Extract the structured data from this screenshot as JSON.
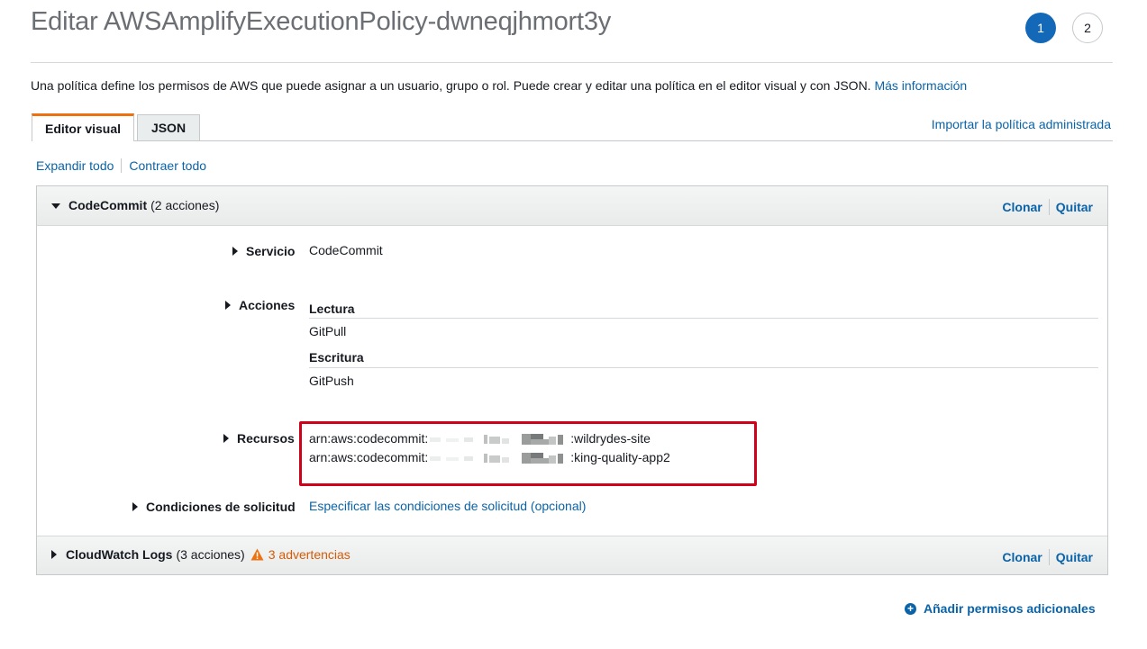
{
  "page": {
    "title": "Editar AWSAmplifyExecutionPolicy-dwneqjhmort3y",
    "steps": [
      "1",
      "2"
    ],
    "intro": "Una política define los permisos de AWS que puede asignar a un usuario, grupo o rol. Puede crear y editar una política en el editor visual y con JSON.",
    "more_info": "Más información"
  },
  "tabs": [
    {
      "label": "Editor visual",
      "active": true
    },
    {
      "label": "JSON",
      "active": false
    }
  ],
  "import_link": "Importar la política administrada",
  "expand_all": "Expandir todo",
  "collapse_all": "Contraer todo",
  "sections": [
    {
      "service": "CodeCommit",
      "count": "(2 acciones)",
      "expanded": true,
      "clone": "Clonar",
      "remove": "Quitar",
      "details": {
        "service_label": "Servicio",
        "service_value": "CodeCommit",
        "actions_label": "Acciones",
        "read_heading": "Lectura",
        "read_action": "GitPull",
        "write_heading": "Escritura",
        "write_action": "GitPush",
        "resources_label": "Recursos",
        "resource_prefix": "arn:aws:codecommit:",
        "resources": [
          ":wildrydes-site",
          ":king-quality-app2"
        ],
        "conditions_label": "Condiciones de solicitud",
        "conditions_link": "Especificar las condiciones de solicitud (opcional)"
      }
    },
    {
      "service": "CloudWatch Logs",
      "count": "(3 acciones)",
      "expanded": false,
      "warnings": "3 advertencias",
      "clone": "Clonar",
      "remove": "Quitar"
    }
  ],
  "add_permissions": "Añadir permisos adicionales",
  "colors": {
    "accent_tab": "#ec7211",
    "link": "#0a63a8",
    "step_active": "#1468b8",
    "warning": "#d45b07",
    "highlight": "#d0021b"
  }
}
